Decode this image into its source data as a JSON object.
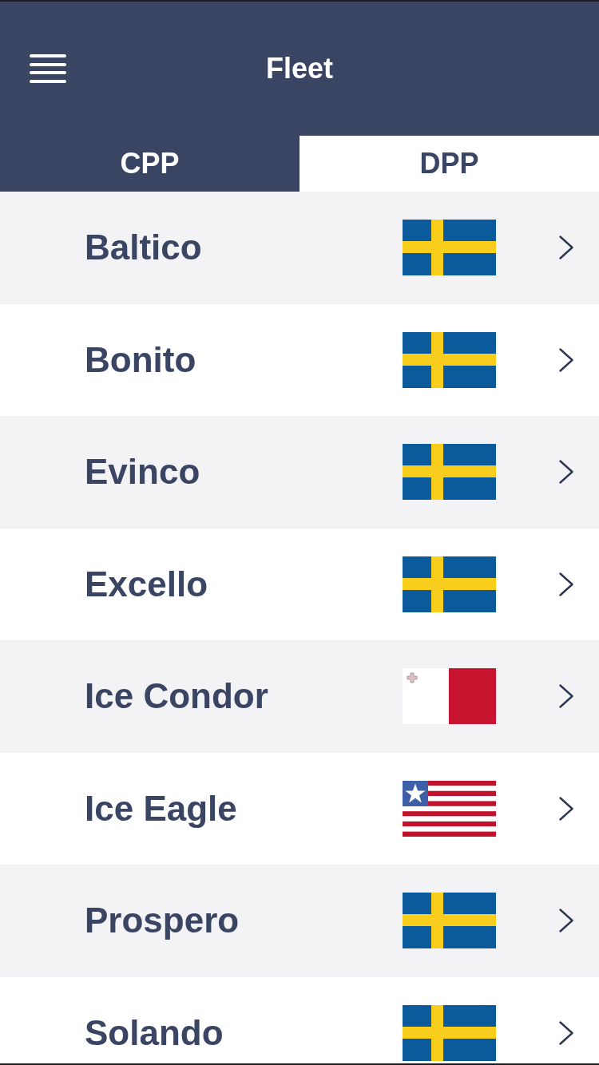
{
  "header": {
    "title": "Fleet"
  },
  "tabs": [
    {
      "label": "CPP",
      "selected": false
    },
    {
      "label": "DPP",
      "selected": true
    }
  ],
  "vessels": [
    {
      "name": "Baltico",
      "flag": {
        "kind": "sweden"
      }
    },
    {
      "name": "Bonito",
      "flag": {
        "kind": "sweden"
      }
    },
    {
      "name": "Evinco",
      "flag": {
        "kind": "sweden"
      }
    },
    {
      "name": "Excello",
      "flag": {
        "kind": "sweden"
      }
    },
    {
      "name": "Ice Condor",
      "flag": {
        "kind": "malta"
      }
    },
    {
      "name": "Ice Eagle",
      "flag": {
        "kind": "liberia"
      }
    },
    {
      "name": "Prospero",
      "flag": {
        "kind": "sweden"
      }
    },
    {
      "name": "Solando",
      "flag": {
        "kind": "sweden"
      }
    }
  ]
}
